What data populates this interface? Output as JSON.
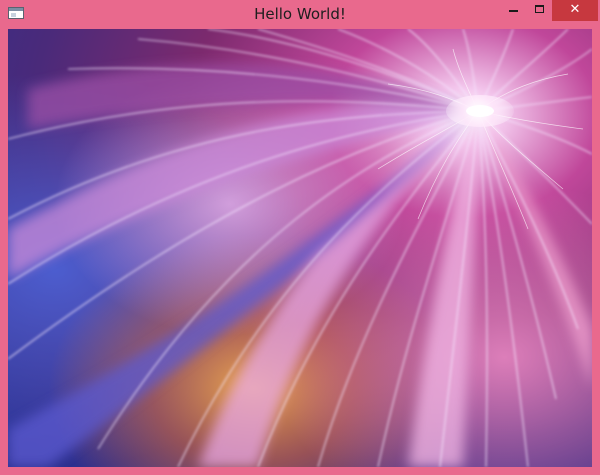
{
  "window": {
    "title": "Hello World!",
    "app_icon": "application-window-icon",
    "controls": {
      "minimize_icon": "minimize-icon",
      "maximize_icon": "maximize-icon",
      "close_icon": "close-icon",
      "close_glyph": "✕"
    },
    "colors": {
      "frame": "#e9698d",
      "close_button": "#c7383f"
    }
  },
  "content": {
    "image": "abstract-swirl-wallpaper",
    "colors": [
      "#3b3fae",
      "#8a2f7a",
      "#d94a8c",
      "#f0a35a",
      "#f6b8e0",
      "#ffffff"
    ]
  }
}
